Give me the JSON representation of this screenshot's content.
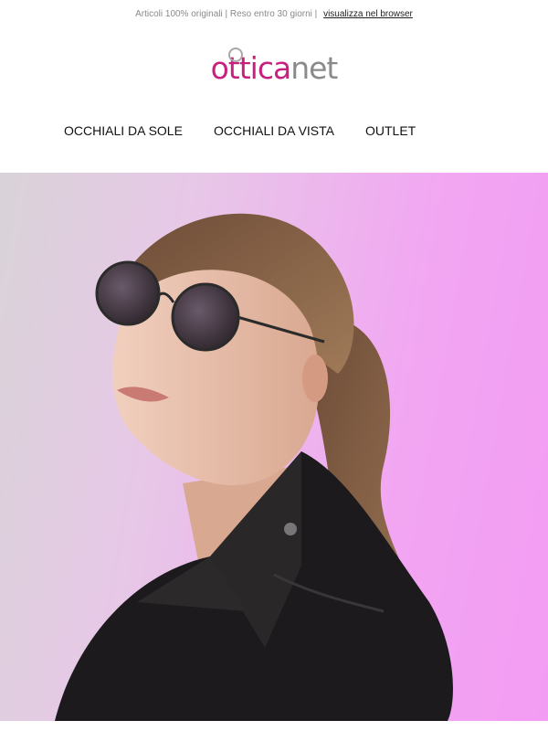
{
  "header": {
    "tagline": "Articoli 100% originali | Reso entro 30 giorni |",
    "browser_link": "visualizza nel browser"
  },
  "logo": {
    "part1": "ottica",
    "part2": "net",
    "colors": {
      "pink": "#c8207e",
      "grey": "#8a8a8a"
    }
  },
  "nav": {
    "items": [
      {
        "label": "OCCHIALI DA SOLE"
      },
      {
        "label": "OCCHIALI DA VISTA"
      },
      {
        "label": "OUTLET"
      }
    ]
  },
  "hero": {
    "image_alt": "",
    "background_colors": [
      "#d9d3d8",
      "#f39cf3"
    ]
  }
}
